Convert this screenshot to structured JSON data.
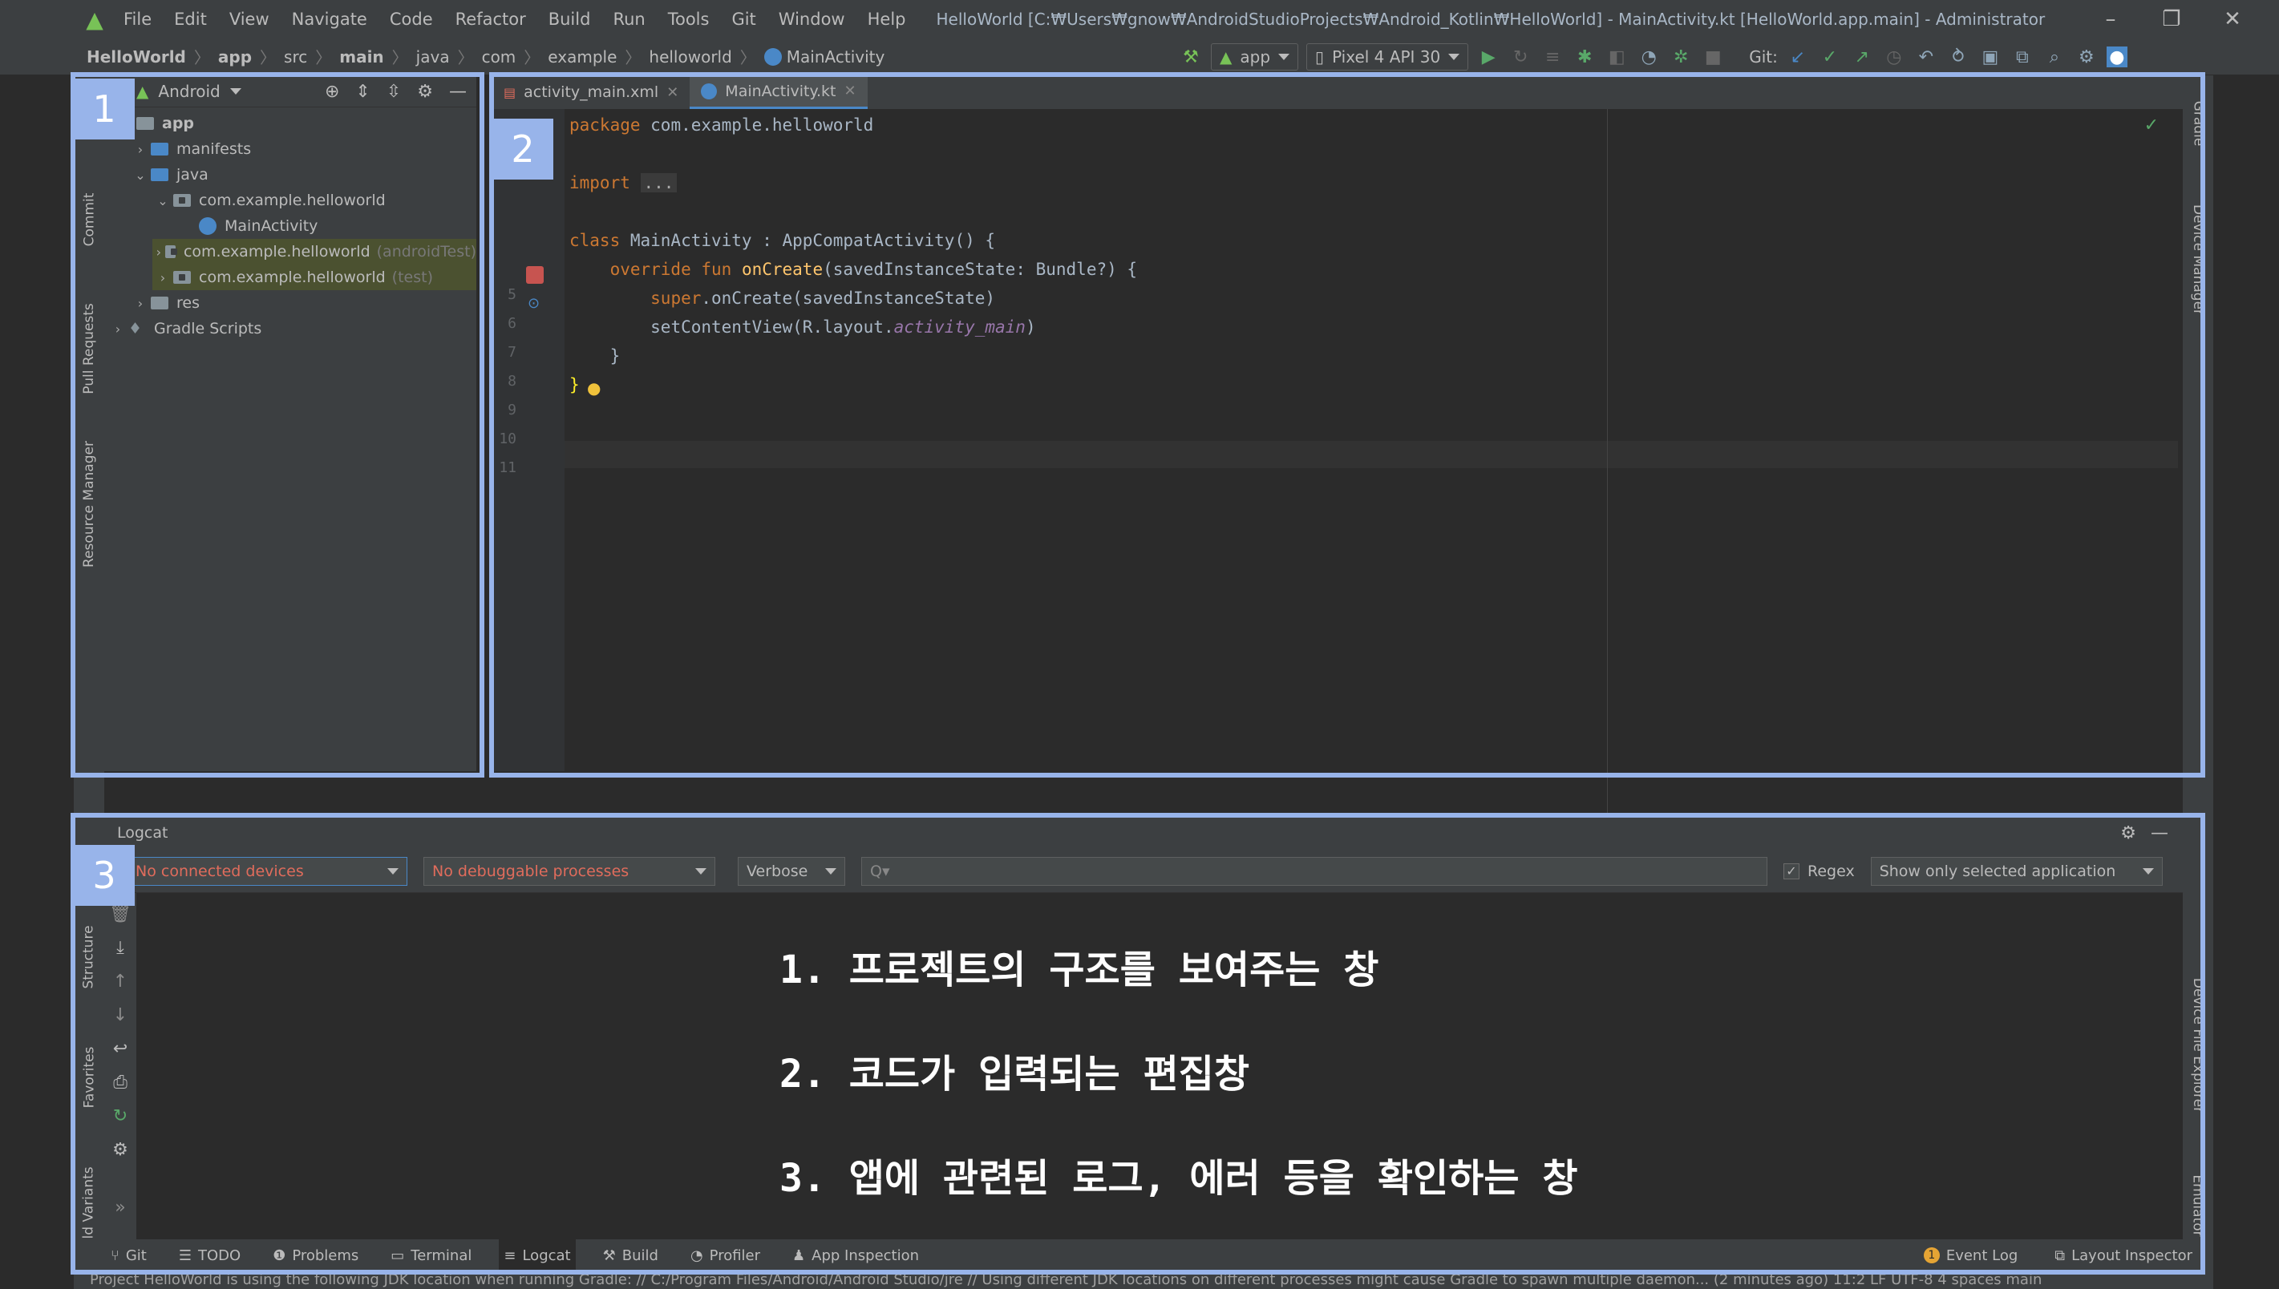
{
  "window": {
    "title": "HelloWorld [C:₩Users₩gnow₩AndroidStudioProjects₩Android_Kotlin₩HelloWorld] - MainActivity.kt [HelloWorld.app.main] - Administrator",
    "menu": [
      "File",
      "Edit",
      "View",
      "Navigate",
      "Code",
      "Refactor",
      "Build",
      "Run",
      "Tools",
      "Git",
      "Window",
      "Help"
    ]
  },
  "breadcrumb": [
    "HelloWorld",
    "app",
    "src",
    "main",
    "java",
    "com",
    "example",
    "helloworld",
    "MainActivity"
  ],
  "toolbar": {
    "run_config": "app",
    "device": "Pixel 4 API 30",
    "git_label": "Git:"
  },
  "project": {
    "view_mode": "Android",
    "tree": [
      {
        "label": "app",
        "depth": 0
      },
      {
        "label": "manifests",
        "depth": 1
      },
      {
        "label": "java",
        "depth": 1
      },
      {
        "label": "com.example.helloworld",
        "depth": 2
      },
      {
        "label": "MainActivity",
        "depth": 3
      },
      {
        "label": "com.example.helloworld",
        "suffix": "(androidTest)",
        "depth": 2
      },
      {
        "label": "com.example.helloworld",
        "suffix": "(test)",
        "depth": 2
      },
      {
        "label": "res",
        "depth": 1
      },
      {
        "label": "Gradle Scripts",
        "depth": 0
      }
    ]
  },
  "editor": {
    "tabs": [
      "activity_main.xml",
      "MainActivity.kt"
    ],
    "active_tab": 1,
    "line_numbers": [
      "",
      "",
      "",
      "5",
      "6",
      "7",
      "8",
      "9",
      "10",
      "11"
    ],
    "code": {
      "l1_kw": "package",
      "l1_rest": " com.example.helloworld",
      "l3_kw": "import",
      "l3_fold": "...",
      "l6_kw": "class",
      "l6_rest": " MainActivity : AppCompatActivity() {",
      "l7_kw": "override fun",
      "l7_fn": "onCreate",
      "l7_rest": "(savedInstanceState: Bundle?) {",
      "l8_kw": "super",
      "l8_rest": ".onCreate(savedInstanceState)",
      "l9_a": "setContentView(R.layout.",
      "l9_it": "activity_main",
      "l9_b": ")",
      "l10": "}",
      "l11": "}"
    }
  },
  "logcat": {
    "title": "Logcat",
    "device": "No connected devices",
    "process": "No debuggable processes",
    "level": "Verbose",
    "search_placeholder": "Q▾",
    "regex_label": "Regex",
    "filter": "Show only selected application"
  },
  "left_tabs": [
    "Commit",
    "Pull Requests",
    "Resource Manager",
    "Structure",
    "Favorites",
    "Build Variants"
  ],
  "right_tabs": [
    "Gradle",
    "Device Manager",
    "Device File Explorer",
    "Emulator"
  ],
  "bottom_tabs": [
    "Git",
    "TODO",
    "Problems",
    "Terminal",
    "Logcat",
    "Build",
    "Profiler",
    "App Inspection"
  ],
  "bottom_right": [
    "Event Log",
    "Layout Inspector"
  ],
  "event_count": "1",
  "status": "Project HelloWorld is using the following JDK location when running Gradle: // C:/Program Files/Android/Android Studio/jre // Using different JDK locations on different processes might cause Gradle to spawn multiple daemon... (2 minutes ago)    11:2    LF    UTF-8    4 spaces    main",
  "annotations": {
    "labels": [
      "1",
      "2",
      "3"
    ],
    "notes": [
      "1. 프로젝트의 구조를 보여주는 창",
      "2. 코드가 입력되는 편집창",
      "3. 앱에 관련된 로그, 에러 등을 확인하는 창"
    ]
  },
  "colors": {
    "frame": "#98b4ea",
    "keyword": "#cc7832",
    "function": "#ffc66d",
    "error_text": "#e06c5c"
  }
}
